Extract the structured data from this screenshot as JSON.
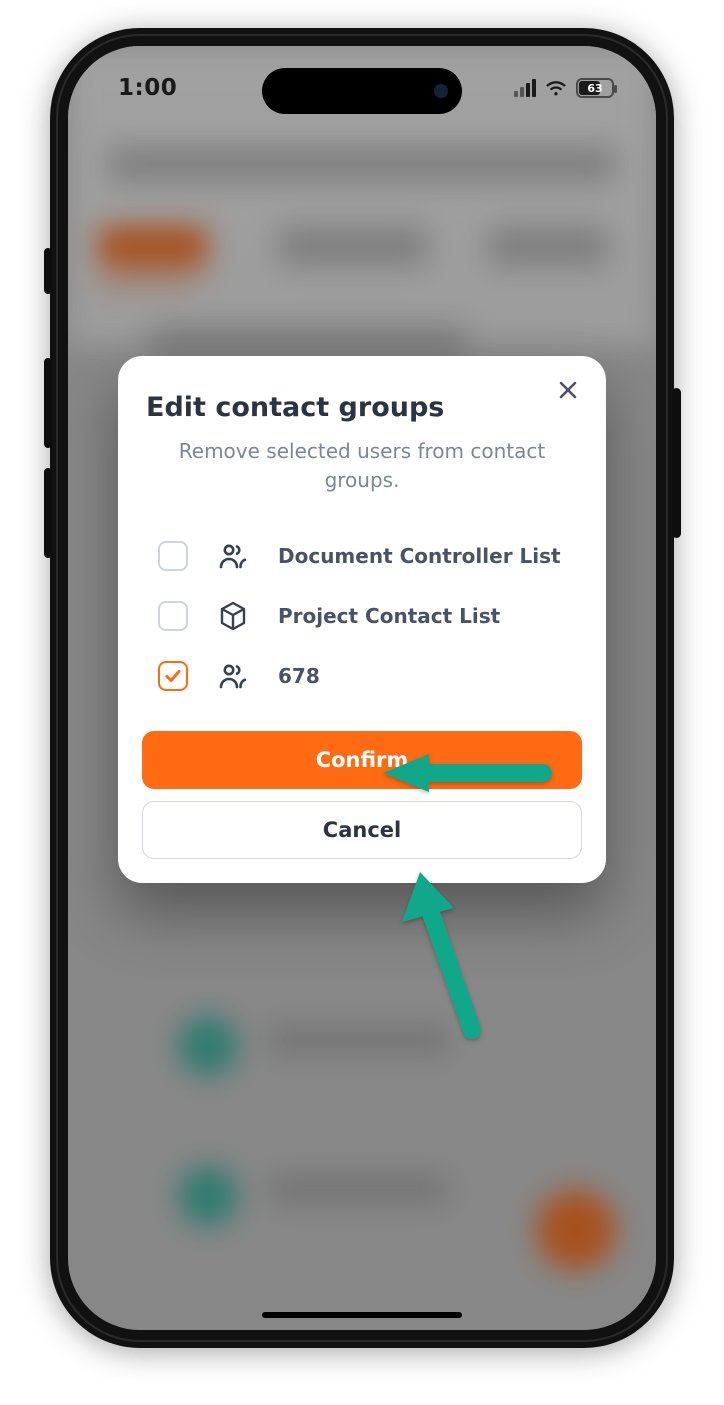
{
  "status": {
    "time": "1:00",
    "battery_text": "63"
  },
  "modal": {
    "title": "Edit contact groups",
    "subtitle": "Remove selected users from contact groups.",
    "confirm_label": "Confirm",
    "cancel_label": "Cancel"
  },
  "groups": {
    "0": {
      "label": "Document Controller List",
      "checked": false,
      "icon": "users"
    },
    "1": {
      "label": "Project Contact List",
      "checked": false,
      "icon": "cube"
    },
    "2": {
      "label": "678",
      "checked": true,
      "icon": "users"
    }
  }
}
